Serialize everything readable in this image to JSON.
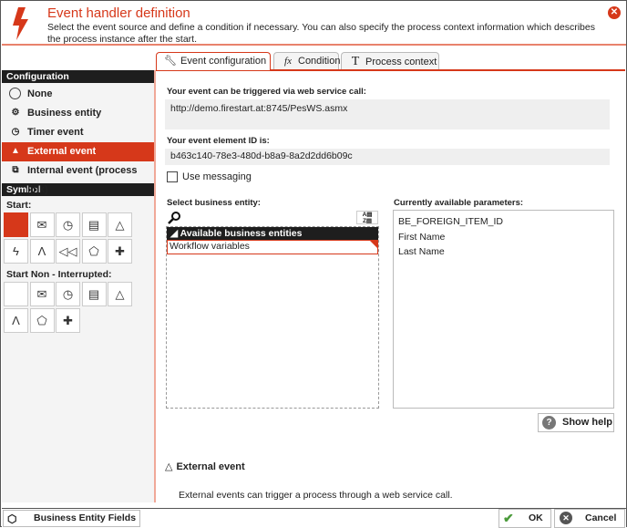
{
  "header": {
    "title": "Event handler definition",
    "subtitle": "Select the event source and define a condition if necessary. You can also specify the process context information which describes the process instance after the start.",
    "close_icon": "close-icon"
  },
  "tabs": [
    {
      "label": "Event configuration",
      "icon": "wrench-icon",
      "active": true
    },
    {
      "label": "Condition",
      "icon": "fx-icon",
      "active": false
    },
    {
      "label": "Process context",
      "icon": "text-icon",
      "active": false
    }
  ],
  "sidebar": {
    "configuration_title": "Configuration",
    "items": [
      {
        "label": "None",
        "icon": "circle-icon"
      },
      {
        "label": "Business entity",
        "icon": "business-entity-icon"
      },
      {
        "label": "Timer event",
        "icon": "clock-icon"
      },
      {
        "label": "External event",
        "icon": "triangle-icon",
        "selected": true
      },
      {
        "label": "Internal event (process link)",
        "icon": "process-link-icon"
      }
    ],
    "symbol_title": "Symbol",
    "start_label": "Start:",
    "start_non_interrupted_label": "Start Non - Interrupted:",
    "start_symbols": [
      "blank",
      "envelope",
      "clock",
      "document",
      "triangle",
      "zigzag",
      "letter-a",
      "rewind",
      "pentagon",
      "cross"
    ],
    "non_interrupted_symbols": [
      "blank",
      "envelope",
      "clock",
      "document",
      "triangle",
      "letter-a",
      "pentagon",
      "cross"
    ]
  },
  "main": {
    "webservice_label": "Your event can be triggered via web service call:",
    "webservice_url": "http://demo.firestart.at:8745/PesWS.asmx",
    "element_id_label": "Your event element ID is:",
    "element_id": "b463c140-78e3-480d-b8a9-8a2d2dd6b09c",
    "use_messaging_label": "Use messaging",
    "use_messaging_checked": false,
    "select_entity_label": "Select business entity:",
    "entities_header": "Available business entities",
    "entities": [
      "Workflow variables"
    ],
    "params_label": "Currently available parameters:",
    "params": [
      "BE_FOREIGN_ITEM_ID",
      "First Name",
      "Last Name"
    ],
    "show_help_label": "Show help",
    "ext_title": "External event",
    "ext_desc": "External events can trigger a process through a web service call."
  },
  "footer": {
    "business_entity_fields_label": "Business Entity Fields",
    "ok_label": "OK",
    "cancel_label": "Cancel"
  },
  "colors": {
    "accent": "#d6381a",
    "header_dark": "#1e1e1e"
  }
}
